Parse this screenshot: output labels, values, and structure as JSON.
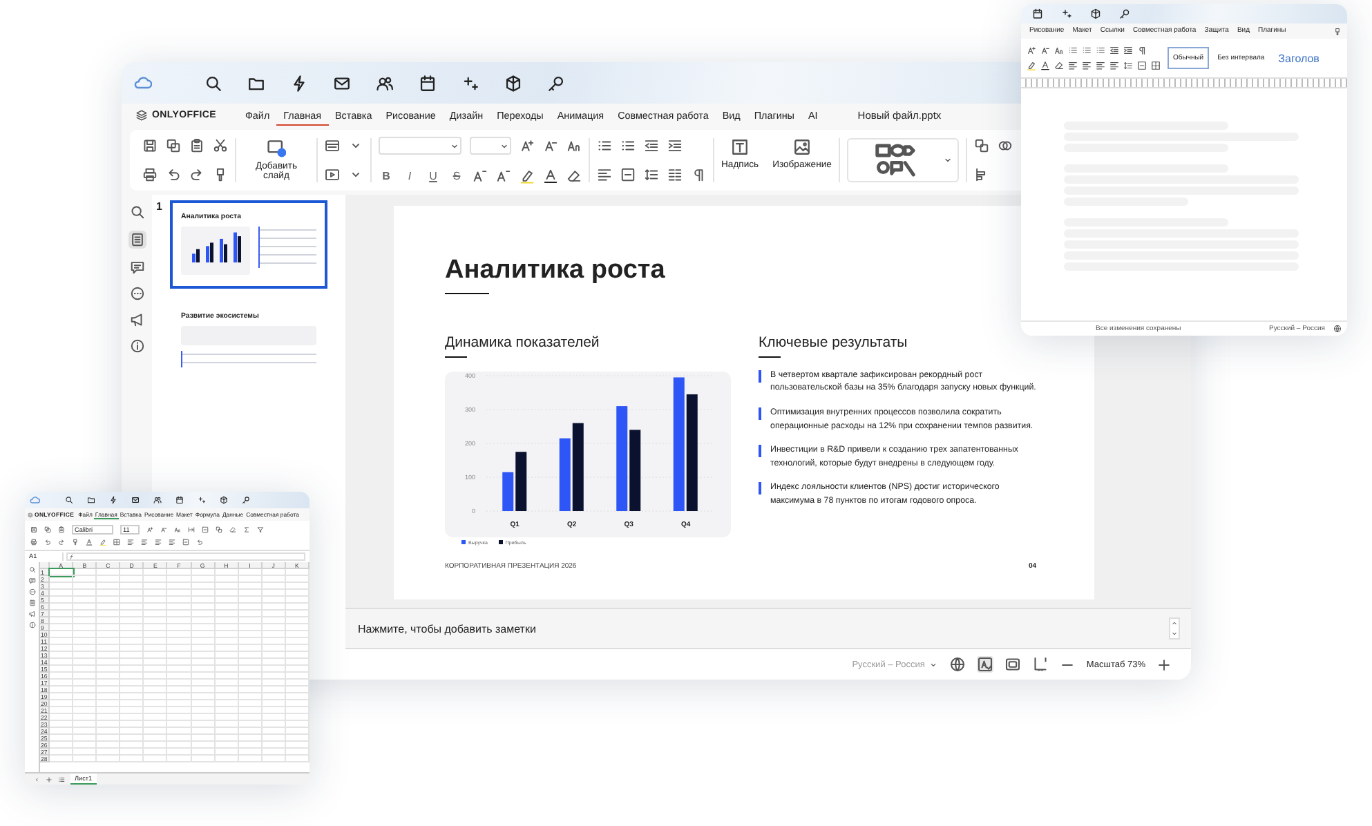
{
  "main_window": {
    "brand": "ONLYOFFICE",
    "menu_tabs": [
      {
        "label": "Файл",
        "selected": false
      },
      {
        "label": "Главная",
        "selected": true
      },
      {
        "label": "Вставка",
        "selected": false
      },
      {
        "label": "Рисование",
        "selected": false
      },
      {
        "label": "Дизайн",
        "selected": false
      },
      {
        "label": "Переходы",
        "selected": false
      },
      {
        "label": "Анимация",
        "selected": false
      },
      {
        "label": "Совместная работа",
        "selected": false
      },
      {
        "label": "Вид",
        "selected": false
      },
      {
        "label": "Плагины",
        "selected": false
      },
      {
        "label": "AI",
        "selected": false
      }
    ],
    "file_name": "Новый файл.pptx",
    "toolbar": {
      "add_slide": "Добавить слайд",
      "format_buttons": [
        "B",
        "I",
        "U",
        "S"
      ],
      "text_box": "Надпись",
      "image": "Изображение"
    },
    "thumbnails": [
      {
        "number": "1",
        "title": "Аналитика роста",
        "kind": "chart",
        "selected": true
      },
      {
        "title": "Развитие экосистемы",
        "kind": "image",
        "selected": false
      }
    ],
    "slide": {
      "title": "Аналитика роста",
      "chart_heading": "Динамика показателей",
      "chart_data": {
        "type": "bar",
        "categories": [
          "Q1",
          "Q2",
          "Q3",
          "Q4"
        ],
        "series": [
          {
            "name": "Выручка",
            "color": "#2e55f5",
            "values": [
              115,
              215,
              310,
              395
            ]
          },
          {
            "name": "Прибыль",
            "color": "#0b1230",
            "values": [
              175,
              260,
              240,
              345
            ]
          }
        ],
        "ylim": [
          0,
          400
        ],
        "yticks": [
          0,
          100,
          200,
          300,
          400
        ],
        "grid": true
      },
      "results_heading": "Ключевые результаты",
      "results": [
        "В четвертом квартале зафиксирован рекордный рост пользовательской базы на 35% благодаря запуску новых функций.",
        "Оптимизация внутренних процессов позволила сократить операционные расходы на 12% при сохранении темпов развития.",
        "Инвестиции в R&D привели к созданию трех запатентованных технологий, которые будут внедрены в следующем году.",
        "Индекс лояльности клиентов (NPS) достиг исторического максимума в 78 пунктов по итогам годового опроса."
      ],
      "footer": "КОРПОРАТИВНАЯ ПРЕЗЕНТАЦИЯ 2026",
      "page": "04"
    },
    "notes_placeholder": "Нажмите, чтобы добавить заметки",
    "status_bar": {
      "language": "Русский – Россия",
      "zoom": "Масштаб 73%"
    }
  },
  "doc_window": {
    "menu_tabs": [
      "Рисование",
      "Макет",
      "Ссылки",
      "Совместная работа",
      "Защита",
      "Вид",
      "Плагины"
    ],
    "styles": [
      {
        "label": "Обычный",
        "selected": true
      },
      {
        "label": "Без интервала",
        "selected": false
      },
      {
        "label": "Заголов",
        "selected": false
      }
    ],
    "status_bar": {
      "save_state": "Все изменения сохранены",
      "language": "Русский – Россия"
    }
  },
  "sheet_window": {
    "brand": "ONLYOFFICE",
    "menu_tabs": [
      {
        "label": "Файл",
        "selected": false
      },
      {
        "label": "Главная",
        "selected": true
      },
      {
        "label": "Вставка",
        "selected": false
      },
      {
        "label": "Рисование",
        "selected": false
      },
      {
        "label": "Макет",
        "selected": false
      },
      {
        "label": "Формула",
        "selected": false
      },
      {
        "label": "Данные",
        "selected": false
      },
      {
        "label": "Совместная работа",
        "selected": false
      }
    ],
    "font": "Calibri",
    "font_size": "11",
    "cell_ref": "A1",
    "columns": [
      "A",
      "B",
      "C",
      "D",
      "E",
      "F",
      "G",
      "H",
      "I",
      "J",
      "K"
    ],
    "rows": [
      "1",
      "2",
      "3",
      "4",
      "5",
      "6",
      "7",
      "8",
      "9",
      "10",
      "11",
      "12",
      "13",
      "14",
      "15",
      "16",
      "17",
      "18",
      "19",
      "20",
      "21",
      "22",
      "23",
      "24",
      "25",
      "26",
      "27",
      "28"
    ],
    "sheet_tabs": [
      {
        "label": "Лист1",
        "selected": true
      }
    ]
  }
}
